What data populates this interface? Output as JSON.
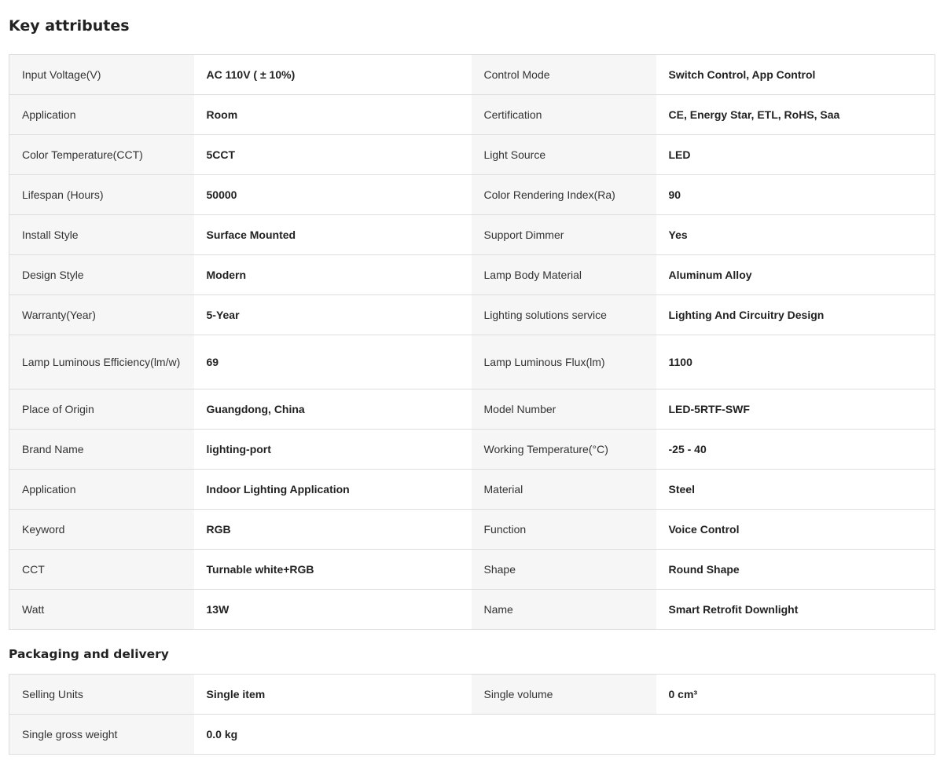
{
  "key_attributes": {
    "title": "Key attributes",
    "rows": [
      [
        {
          "label": "Input Voltage(V)",
          "value": "AC 110V ( ± 10%)"
        },
        {
          "label": "Control Mode",
          "value": "Switch Control, App Control"
        }
      ],
      [
        {
          "label": "Application",
          "value": "Room"
        },
        {
          "label": "Certification",
          "value": "CE, Energy Star, ETL, RoHS, Saa"
        }
      ],
      [
        {
          "label": "Color Temperature(CCT)",
          "value": "5CCT"
        },
        {
          "label": "Light Source",
          "value": "LED"
        }
      ],
      [
        {
          "label": "Lifespan (Hours)",
          "value": "50000"
        },
        {
          "label": "Color Rendering Index(Ra)",
          "value": "90"
        }
      ],
      [
        {
          "label": "Install Style",
          "value": "Surface Mounted"
        },
        {
          "label": "Support Dimmer",
          "value": "Yes"
        }
      ],
      [
        {
          "label": "Design Style",
          "value": "Modern"
        },
        {
          "label": "Lamp Body Material",
          "value": "Aluminum Alloy"
        }
      ],
      [
        {
          "label": "Warranty(Year)",
          "value": "5-Year"
        },
        {
          "label": "Lighting solutions service",
          "value": "Lighting And Circuitry Design"
        }
      ],
      [
        {
          "label": "Lamp Luminous Efficiency(lm/w)",
          "value": "69"
        },
        {
          "label": "Lamp Luminous Flux(lm)",
          "value": "1100"
        }
      ],
      [
        {
          "label": "Place of Origin",
          "value": "Guangdong, China"
        },
        {
          "label": "Model Number",
          "value": "LED-5RTF-SWF"
        }
      ],
      [
        {
          "label": "Brand Name",
          "value": "lighting-port"
        },
        {
          "label": "Working Temperature(°C)",
          "value": "-25 - 40"
        }
      ],
      [
        {
          "label": "Application",
          "value": "Indoor Lighting Application"
        },
        {
          "label": "Material",
          "value": "Steel"
        }
      ],
      [
        {
          "label": "Keyword",
          "value": "RGB"
        },
        {
          "label": "Function",
          "value": "Voice Control"
        }
      ],
      [
        {
          "label": "CCT",
          "value": "Turnable white+RGB"
        },
        {
          "label": "Shape",
          "value": "Round Shape"
        }
      ],
      [
        {
          "label": "Watt",
          "value": "13W"
        },
        {
          "label": "Name",
          "value": "Smart Retrofit Downlight"
        }
      ]
    ]
  },
  "packaging": {
    "title": "Packaging and delivery",
    "rows": [
      [
        {
          "label": "Selling Units",
          "value": "Single item"
        },
        {
          "label": "Single volume",
          "value": "0 cm³"
        }
      ],
      [
        {
          "label": "Single gross weight",
          "value": "0.0 kg"
        }
      ]
    ]
  }
}
